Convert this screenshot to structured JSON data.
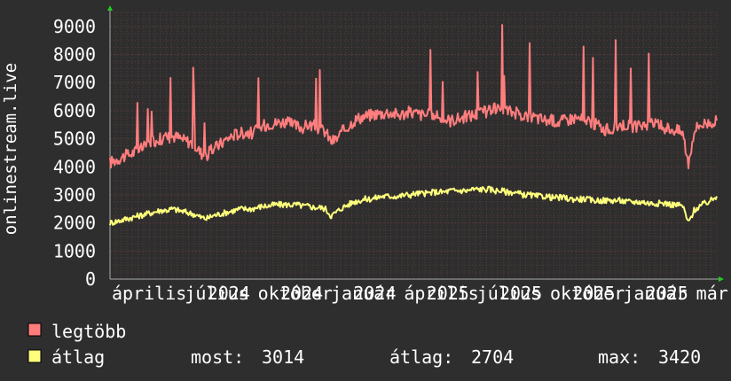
{
  "chart_data": {
    "type": "line",
    "ylabel": "onlinestream.live",
    "ylim": [
      0,
      9500
    ],
    "y_ticks": [
      "0",
      "1000",
      "2000",
      "3000",
      "4000",
      "5000",
      "6000",
      "7000",
      "8000",
      "9000"
    ],
    "x_tick_labels": [
      "április",
      "július",
      "2024",
      "október",
      "2024",
      "január",
      "2024",
      "április",
      "2025",
      "július",
      "2025",
      "október",
      "2025",
      "január",
      "2025",
      "már"
    ],
    "x_range_weeks": [
      0,
      108
    ],
    "x_ticks_at_weeks": [
      0,
      13,
      17,
      26,
      30,
      39,
      43,
      52,
      56,
      65,
      69,
      78,
      82,
      91,
      95,
      104
    ],
    "grid": true,
    "series": [
      {
        "name": "legtöbb",
        "color": "#ff7d7d",
        "values": [
          4150,
          4250,
          4350,
          4400,
          4500,
          4600,
          4700,
          4850,
          4950,
          5000,
          5050,
          5100,
          5050,
          4950,
          4900,
          4750,
          4500,
          4400,
          4600,
          4750,
          4900,
          5050,
          5150,
          5200,
          5250,
          5200,
          5300,
          5450,
          5550,
          5550,
          5600,
          5600,
          5500,
          5450,
          5400,
          5500,
          5450,
          5350,
          5250,
          4900,
          5000,
          5250,
          5450,
          5650,
          5750,
          5800,
          5850,
          5900,
          5900,
          5950,
          5900,
          5850,
          5900,
          5950,
          5900,
          5850,
          5850,
          5800,
          5750,
          5700,
          5650,
          5700,
          5750,
          5800,
          5850,
          5900,
          5950,
          6000,
          6050,
          6050,
          6000,
          5950,
          5900,
          5850,
          5800,
          5750,
          5700,
          5650,
          5650,
          5600,
          5650,
          5700,
          5750,
          5700,
          5650,
          5550,
          5500,
          5350,
          5300,
          5400,
          5500,
          5500,
          5450,
          5400,
          5500,
          5550,
          5500,
          5450,
          5400,
          5350,
          5300,
          5200,
          4100,
          5300,
          5500,
          5550,
          5600,
          5650
        ]
      },
      {
        "name": "átlag",
        "color": "#ffff7d",
        "values": [
          2000,
          2050,
          2100,
          2150,
          2200,
          2250,
          2300,
          2350,
          2400,
          2450,
          2450,
          2500,
          2450,
          2400,
          2350,
          2300,
          2200,
          2150,
          2250,
          2300,
          2350,
          2400,
          2450,
          2500,
          2500,
          2500,
          2550,
          2600,
          2600,
          2650,
          2650,
          2650,
          2650,
          2650,
          2600,
          2600,
          2550,
          2550,
          2500,
          2250,
          2400,
          2550,
          2650,
          2750,
          2800,
          2850,
          2850,
          2900,
          2950,
          2950,
          2950,
          2950,
          3000,
          3000,
          3050,
          3050,
          3050,
          3100,
          3100,
          3100,
          3150,
          3150,
          3150,
          3150,
          3200,
          3200,
          3200,
          3200,
          3150,
          3150,
          3100,
          3100,
          3050,
          3000,
          3000,
          2950,
          2950,
          2950,
          2900,
          2900,
          2900,
          2850,
          2850,
          2850,
          2850,
          2800,
          2800,
          2800,
          2800,
          2800,
          2800,
          2750,
          2750,
          2750,
          2750,
          2700,
          2700,
          2700,
          2700,
          2650,
          2650,
          2600,
          2000,
          2450,
          2600,
          2700,
          2800,
          2950
        ]
      }
    ]
  },
  "legend": {
    "series1_label": "legtöbb",
    "series2_label": "átlag",
    "most_label": "most:",
    "most_value": "3014",
    "atlag_label": "átlag:",
    "atlag_value": "2704",
    "max_label": "max:",
    "max_value": "3420"
  },
  "colors": {
    "background": "#2e2e2e",
    "plot_background": "#2e2e2e",
    "grid": "#5a3a3a",
    "axis_arrow": "#22cc22",
    "text": "#ffffff"
  }
}
